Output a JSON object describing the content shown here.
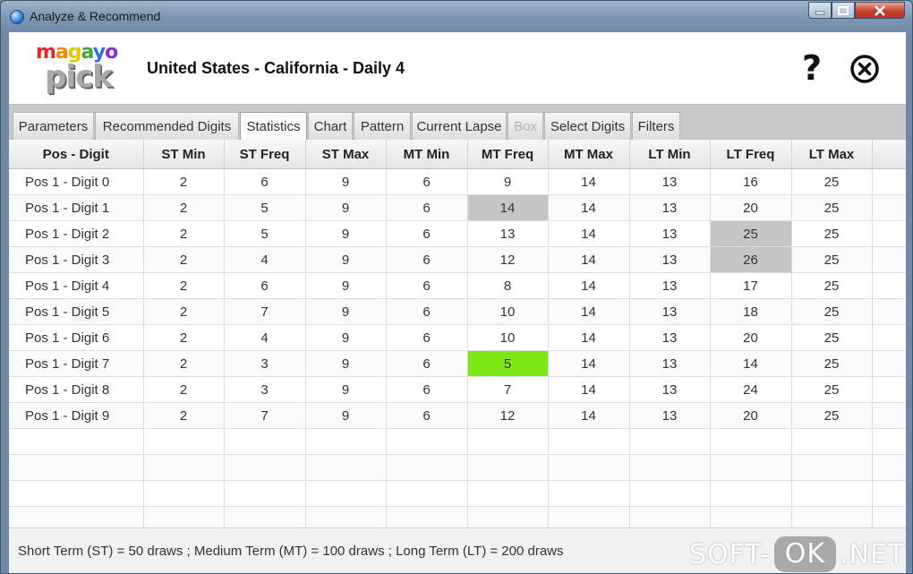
{
  "window": {
    "title": "Analyze & Recommend"
  },
  "header": {
    "logo_line1": "magayo",
    "logo_line2": "pick",
    "title": "United States - California - Daily 4",
    "help_label": "?"
  },
  "tabs": [
    {
      "label": "Parameters",
      "state": "normal"
    },
    {
      "label": "Recommended Digits",
      "state": "normal"
    },
    {
      "label": "Statistics",
      "state": "active"
    },
    {
      "label": "Chart",
      "state": "normal"
    },
    {
      "label": "Pattern",
      "state": "normal"
    },
    {
      "label": "Current Lapse",
      "state": "normal"
    },
    {
      "label": "Box",
      "state": "disabled"
    },
    {
      "label": "Select Digits",
      "state": "normal"
    },
    {
      "label": "Filters",
      "state": "normal"
    }
  ],
  "table": {
    "columns": [
      "Pos - Digit",
      "ST Min",
      "ST Freq",
      "ST Max",
      "MT Min",
      "MT Freq",
      "MT Max",
      "LT Min",
      "LT Freq",
      "LT Max"
    ],
    "rows": [
      [
        "Pos 1 - Digit 0",
        "2",
        "6",
        "9",
        "6",
        "9",
        "14",
        "13",
        "16",
        "25"
      ],
      [
        "Pos 1 - Digit 1",
        "2",
        "5",
        "9",
        "6",
        "14",
        "14",
        "13",
        "20",
        "25"
      ],
      [
        "Pos 1 - Digit 2",
        "2",
        "5",
        "9",
        "6",
        "13",
        "14",
        "13",
        "25",
        "25"
      ],
      [
        "Pos 1 - Digit 3",
        "2",
        "4",
        "9",
        "6",
        "12",
        "14",
        "13",
        "26",
        "25"
      ],
      [
        "Pos 1 - Digit 4",
        "2",
        "6",
        "9",
        "6",
        "8",
        "14",
        "13",
        "17",
        "25"
      ],
      [
        "Pos 1 - Digit 5",
        "2",
        "7",
        "9",
        "6",
        "10",
        "14",
        "13",
        "18",
        "25"
      ],
      [
        "Pos 1 - Digit 6",
        "2",
        "4",
        "9",
        "6",
        "10",
        "14",
        "13",
        "20",
        "25"
      ],
      [
        "Pos 1 - Digit 7",
        "2",
        "3",
        "9",
        "6",
        "5",
        "14",
        "13",
        "14",
        "25"
      ],
      [
        "Pos 1 - Digit 8",
        "2",
        "3",
        "9",
        "6",
        "7",
        "14",
        "13",
        "24",
        "25"
      ],
      [
        "Pos 1 - Digit 9",
        "2",
        "7",
        "9",
        "6",
        "12",
        "14",
        "13",
        "20",
        "25"
      ]
    ],
    "highlights": [
      {
        "row": 1,
        "col": 5,
        "color": "#c6c6c6"
      },
      {
        "row": 2,
        "col": 8,
        "color": "#c6c6c6"
      },
      {
        "row": 3,
        "col": 8,
        "color": "#c6c6c6"
      },
      {
        "row": 7,
        "col": 5,
        "color": "#7ee817"
      }
    ],
    "empty_rows": 4
  },
  "footer": {
    "note": "Short Term (ST) = 50 draws ; Medium Term (MT) = 100 draws ; Long Term (LT) = 200 draws",
    "watermark_left": "SOFT-",
    "watermark_mid": "OK",
    "watermark_right": ".NET"
  },
  "colors": {
    "logo_letters": [
      "#e8232a",
      "#f08a00",
      "#e6c800",
      "#36a936",
      "#2a6fd6",
      "#8a2ad6"
    ]
  }
}
